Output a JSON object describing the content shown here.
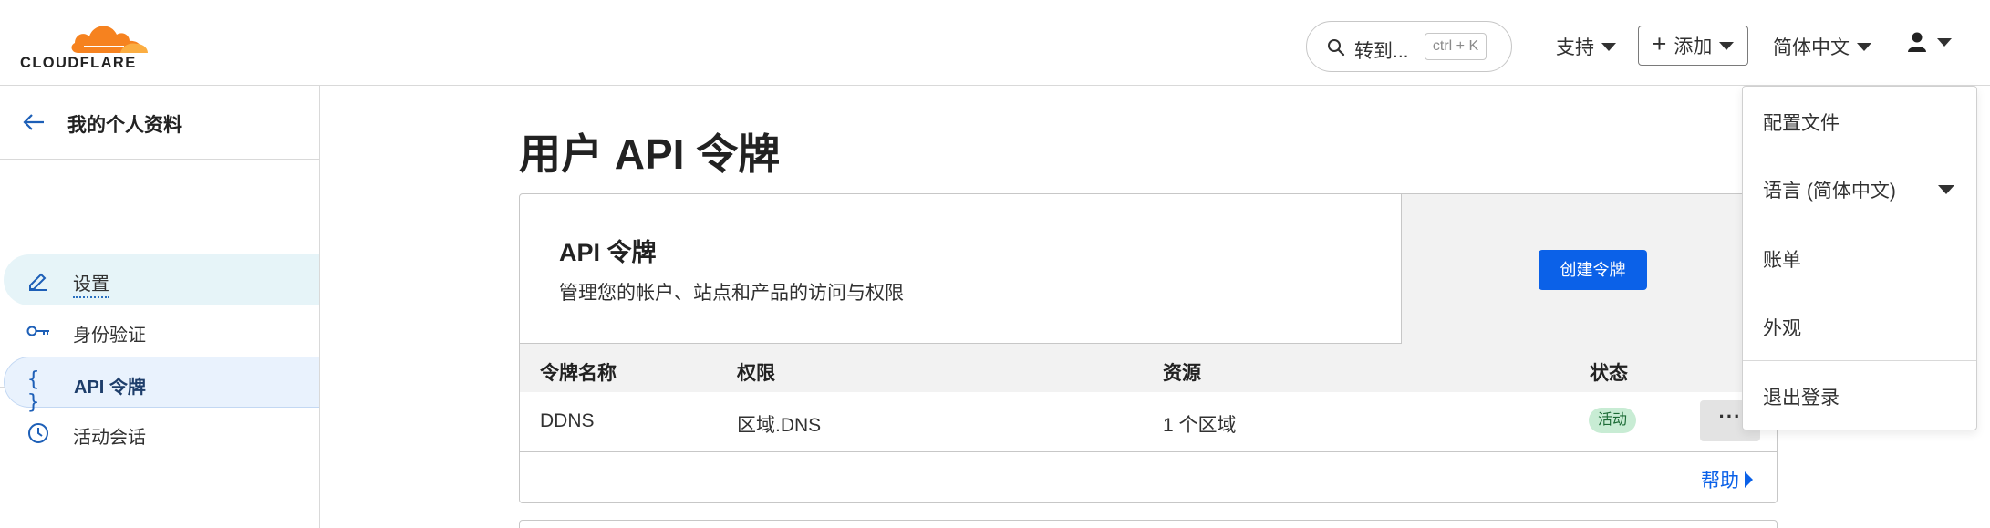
{
  "brand": {
    "logo_text": "CLOUDFLARE",
    "orange": "#f6821f"
  },
  "header": {
    "search_label": "转到...",
    "search_shortcut": "ctrl + K",
    "support_label": "支持",
    "add_label": "添加",
    "language_label": "简体中文"
  },
  "sidebar": {
    "title": "我的个人资料",
    "items": [
      {
        "label": "设置",
        "icon": "pencil-icon"
      },
      {
        "label": "身份验证",
        "icon": "key-icon"
      },
      {
        "label": "API 令牌",
        "icon": "braces-icon"
      },
      {
        "label": "活动会话",
        "icon": "clock-icon"
      }
    ]
  },
  "main": {
    "page_title": "用户 API 令牌",
    "card": {
      "heading": "API 令牌",
      "description": "管理您的帐户、站点和产品的访问与权限",
      "create_button": "创建令牌"
    },
    "table": {
      "columns": [
        "令牌名称",
        "权限",
        "资源",
        "状态"
      ],
      "rows": [
        {
          "name": "DDNS",
          "permission": "区域.DNS",
          "resource": "1 个区域",
          "status": "活动",
          "more": "···"
        }
      ]
    },
    "help_link": "帮助"
  },
  "user_menu": {
    "items": [
      "配置文件",
      "语言 (简体中文)",
      "账单",
      "外观",
      "退出登录"
    ]
  },
  "colors": {
    "primary": "#0b61e8",
    "badge_bg": "#c8ecd4",
    "badge_text": "#1c6b36"
  }
}
